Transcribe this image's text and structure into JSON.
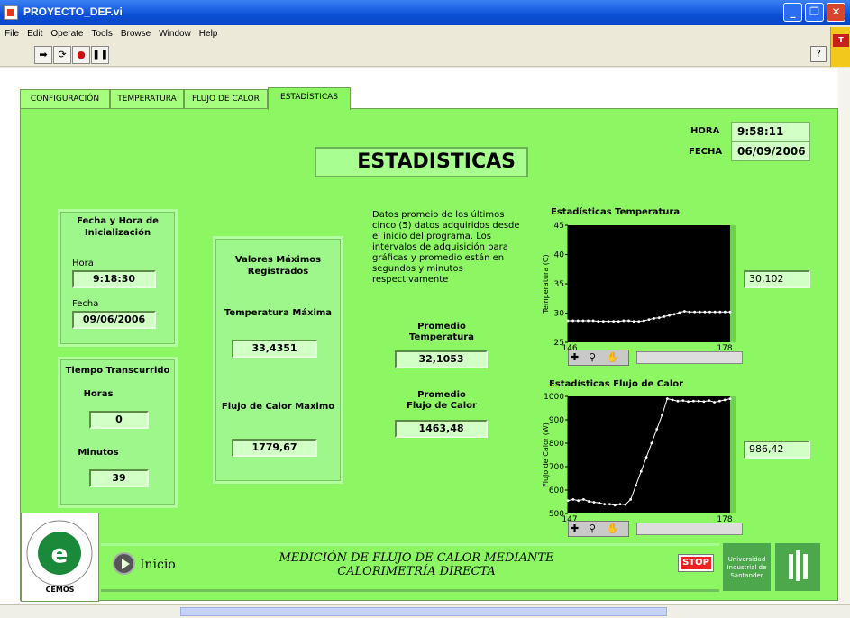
{
  "window": {
    "title": "PROYECTO_DEF.vi",
    "minimize": "_",
    "restore": "❐",
    "close": "✕"
  },
  "menu": [
    "File",
    "Edit",
    "Operate",
    "Tools",
    "Browse",
    "Window",
    "Help"
  ],
  "toolbar": {
    "help": "?"
  },
  "tabs": [
    "CONFIGURACIÓN",
    "TEMPERATURA",
    "FLUJO DE CALOR",
    "ESTADÍSTICAS"
  ],
  "active_tab": "ESTADÍSTICAS",
  "header": {
    "hora_label": "HORA",
    "hora_value": "9:58:11",
    "fecha_label": "FECHA",
    "fecha_value": "06/09/2006"
  },
  "page_title": "ESTADISTICAS",
  "init": {
    "title_line1": "Fecha y Hora de",
    "title_line2": "Inicialización",
    "hora_label": "Hora",
    "hora_value": "9:18:30",
    "fecha_label": "Fecha",
    "fecha_value": "09/06/2006"
  },
  "elapsed": {
    "title": "Tiempo Transcurrido",
    "horas_label": "Horas",
    "horas_value": "0",
    "minutos_label": "Minutos",
    "minutos_value": "39"
  },
  "max": {
    "title_line1": "Valores Máximos",
    "title_line2": "Registrados",
    "temp_label": "Temperatura Máxima",
    "temp_value": "33,4351",
    "flujo_label": "Flujo de Calor Maximo",
    "flujo_value": "1779,67"
  },
  "description": "Datos promeio de los últimos cinco (5) datos adquiridos desde el inicio del programa. Los intervalos de adquisición para gráficas y  promedio están en segundos y minutos respectivamente",
  "avg": {
    "temp_label1": "Promedio",
    "temp_label2": "Temperatura",
    "temp_value": "32,1053",
    "flujo_label1": "Promedio",
    "flujo_label2": "Flujo de Calor",
    "flujo_value": "1463,48"
  },
  "chart_temp_value": "30,102",
  "chart_flujo_value": "986,42",
  "footer": {
    "line1": "MEDICIÓN DE FLUJO DE CALOR MEDIANTE",
    "line2": "CALORIMETRÍA DIRECTA",
    "inicio": "Inicio",
    "stop": "STOP",
    "logo_text": "CEMOS",
    "uis_text1": "Universidad",
    "uis_text2": "Industrial de",
    "uis_text3": "Santander"
  },
  "chart_data": [
    {
      "type": "line",
      "title": "Estadísticas Temperatura",
      "ylabel": "Temperatura (C)",
      "xlabel": "",
      "xlim": [
        146,
        178
      ],
      "ylim": [
        25,
        45
      ],
      "yticks": [
        25,
        30,
        35,
        40,
        45
      ],
      "xticks": [
        146,
        178
      ],
      "grid": false,
      "color": "#ffffff",
      "x": [
        146,
        147,
        148,
        149,
        150,
        151,
        152,
        153,
        154,
        155,
        156,
        157,
        158,
        159,
        160,
        161,
        162,
        163,
        164,
        165,
        166,
        167,
        168,
        169,
        170,
        171,
        172,
        173,
        174,
        175,
        176,
        177,
        178
      ],
      "y": [
        28.7,
        28.7,
        28.7,
        28.7,
        28.7,
        28.7,
        28.6,
        28.6,
        28.6,
        28.6,
        28.6,
        28.7,
        28.7,
        28.6,
        28.6,
        28.7,
        28.9,
        29.1,
        29.2,
        29.4,
        29.6,
        29.8,
        30.1,
        30.3,
        30.2,
        30.2,
        30.2,
        30.2,
        30.2,
        30.2,
        30.2,
        30.2,
        30.2
      ]
    },
    {
      "type": "line",
      "title": "Estadísticas Flujo de Calor",
      "ylabel": "Flujo de Calor (W)",
      "xlabel": "",
      "xlim": [
        147,
        178
      ],
      "ylim": [
        500,
        1000
      ],
      "yticks": [
        500,
        600,
        700,
        800,
        900,
        1000
      ],
      "xticks": [
        147,
        178
      ],
      "grid": false,
      "color": "#ffffff",
      "x": [
        147,
        148,
        149,
        150,
        151,
        152,
        153,
        154,
        155,
        156,
        157,
        158,
        159,
        160,
        161,
        162,
        163,
        164,
        165,
        166,
        167,
        168,
        169,
        170,
        171,
        172,
        173,
        174,
        175,
        176,
        177,
        178
      ],
      "y": [
        555,
        560,
        555,
        560,
        552,
        548,
        545,
        540,
        540,
        535,
        540,
        538,
        560,
        620,
        680,
        740,
        800,
        860,
        920,
        990,
        985,
        980,
        982,
        978,
        980,
        980,
        978,
        982,
        975,
        980,
        985,
        990
      ]
    }
  ]
}
